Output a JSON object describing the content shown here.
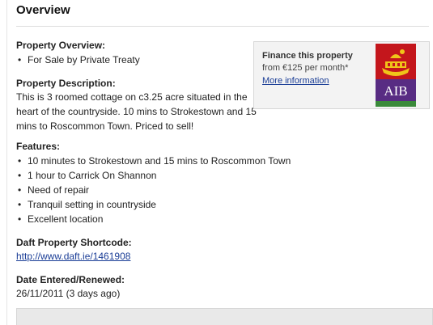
{
  "overview": {
    "title": "Overview"
  },
  "property_overview": {
    "heading": "Property Overview:",
    "items": [
      "For Sale by Private Treaty"
    ]
  },
  "property_description": {
    "heading": "Property Description:",
    "lines": [
      "This is 3 roomed cottage on c3.25 acre situated in the",
      "heart of the countryside. 10 mins to Strokestown and 15",
      "mins to Roscommon Town. Priced to sell!"
    ]
  },
  "features": {
    "heading": "Features:",
    "items": [
      "10 minutes to Strokestown and 15 mins to Roscommon Town",
      "1 hour to Carrick On Shannon",
      "Need of repair",
      "Tranquil setting in countryside",
      "Excellent location"
    ]
  },
  "shortcode": {
    "heading": "Daft Property Shortcode:",
    "url": "http://www.daft.ie/1461908"
  },
  "date_entered": {
    "heading": "Date Entered/Renewed:",
    "value": "26/11/2011 (3 days ago)"
  },
  "finance": {
    "title": "Finance this property",
    "subtitle": "from €125 per month*",
    "link": "More information",
    "logo_text": "AIB",
    "logo_colors": {
      "top_red": "#c4161c",
      "purple": "#582c83",
      "green": "#3a8a3a",
      "gold": "#f0c419"
    }
  }
}
